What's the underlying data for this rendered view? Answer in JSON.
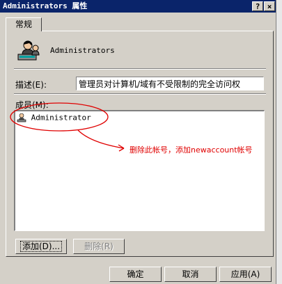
{
  "window": {
    "title": "Administrators 属性",
    "help_glyph": "?",
    "close_glyph": "×"
  },
  "tabs": [
    {
      "label": "常规"
    }
  ],
  "group": {
    "name": "Administrators",
    "icon": "group-users-icon"
  },
  "description": {
    "label": "描述(E):",
    "value": "管理员对计算机/域有不受限制的完全访问权"
  },
  "members": {
    "label": "成员(M):",
    "items": [
      {
        "name": "Administrator",
        "icon": "user-icon"
      }
    ]
  },
  "annotation": {
    "text": "删除此帐号，添加newaccount帐号",
    "color": "#e00000"
  },
  "buttons": {
    "add": "添加(D)...",
    "remove": "删除(R)",
    "ok": "确定",
    "cancel": "取消",
    "apply": "应用(A)"
  }
}
